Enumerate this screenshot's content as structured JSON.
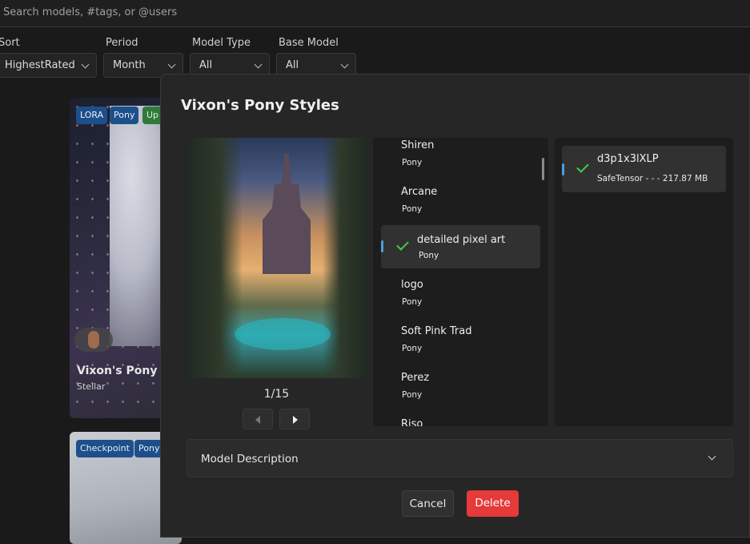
{
  "search": {
    "placeholder": "Search models, #tags, or @users"
  },
  "filters": [
    {
      "label": "Sort",
      "value": "HighestRated"
    },
    {
      "label": "Period",
      "value": "Month"
    },
    {
      "label": "Model Type",
      "value": "All"
    },
    {
      "label": "Base Model",
      "value": "All"
    }
  ],
  "cards": [
    {
      "badges": [
        "LORA",
        "Pony",
        "Up"
      ],
      "title": "Vixon's Pony Sty",
      "author": "Stellar"
    },
    {
      "badges": [
        "Checkpoint",
        "Pony"
      ]
    }
  ],
  "modal": {
    "title": "Vixon's Pony Styles",
    "preview_counter": "1/15",
    "versions": [
      {
        "name": "Shiren",
        "base": "Pony"
      },
      {
        "name": "Arcane",
        "base": "Pony"
      },
      {
        "name": "detailed pixel art",
        "base": "Pony",
        "selected": true
      },
      {
        "name": "logo",
        "base": "Pony"
      },
      {
        "name": "Soft Pink Trad",
        "base": "Pony"
      },
      {
        "name": "Perez",
        "base": "Pony"
      },
      {
        "name": "Riso",
        "base": ""
      }
    ],
    "files": [
      {
        "name": "d3p1x3lXLP",
        "meta": "SafeTensor -  - - 217.87 MB",
        "selected": true
      }
    ],
    "description_label": "Model Description",
    "cancel_label": "Cancel",
    "delete_label": "Delete"
  },
  "colors": {
    "accent_blue": "#4a9ede",
    "check_green": "#3ecf4a",
    "delete_red": "#e5393a"
  }
}
